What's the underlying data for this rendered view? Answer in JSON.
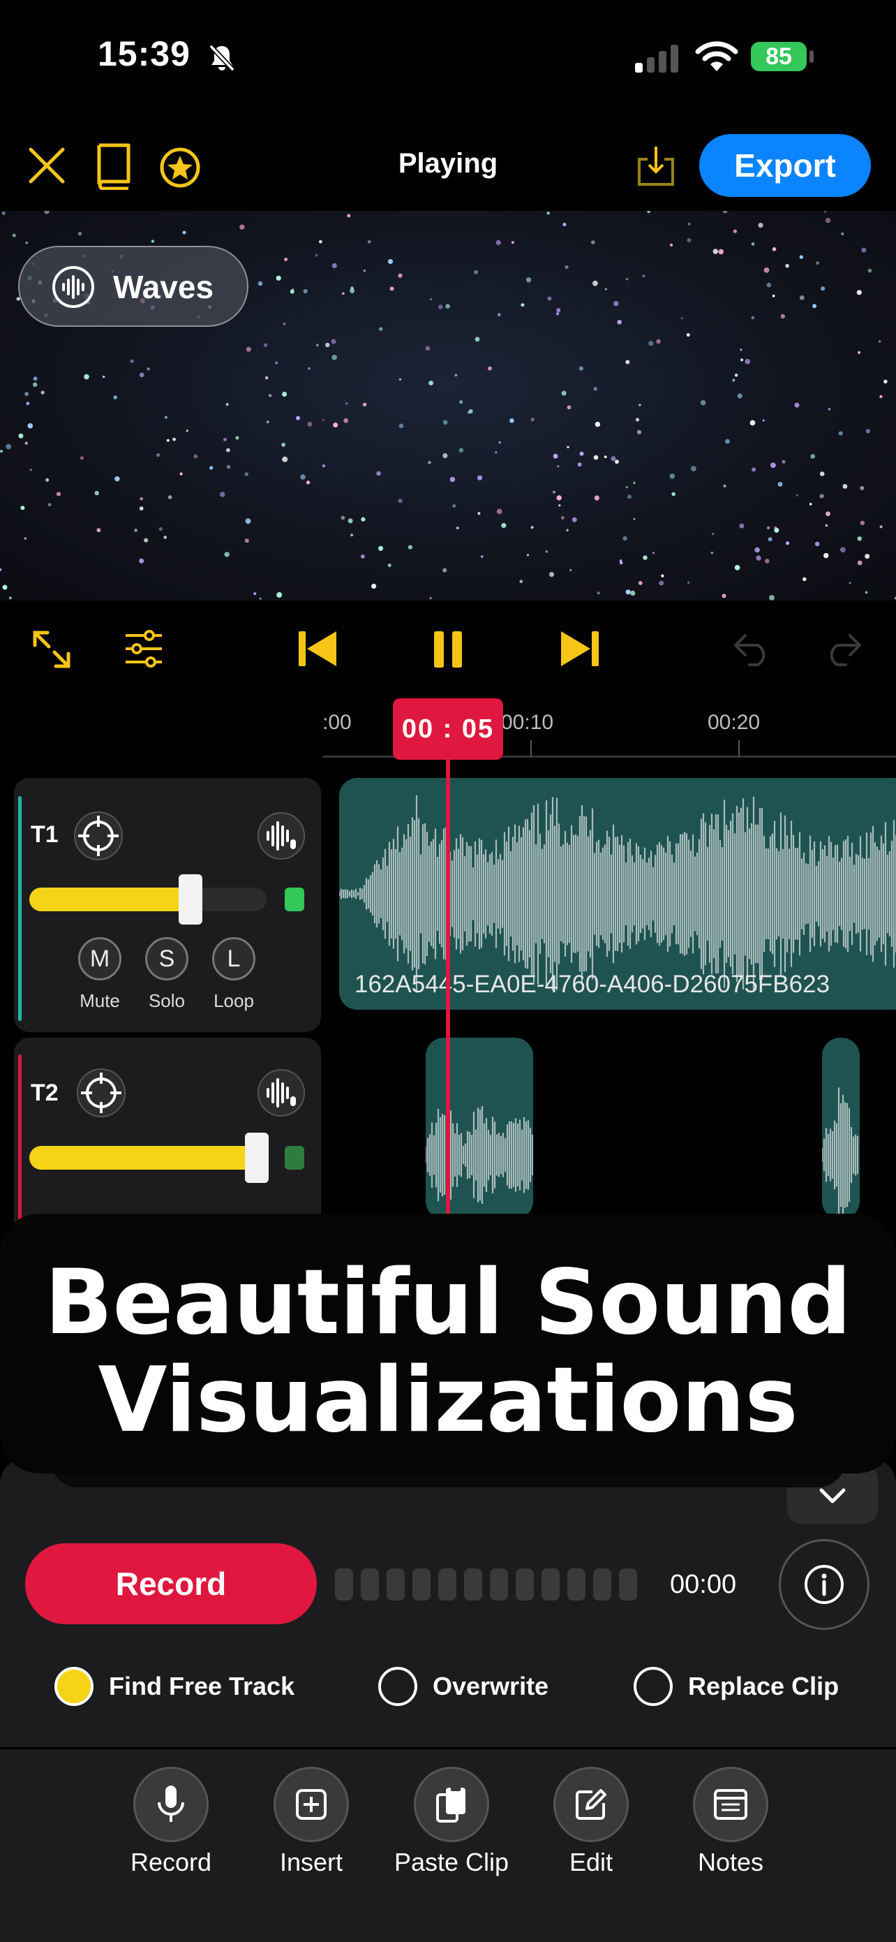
{
  "status_bar": {
    "time": "15:39",
    "battery": "85"
  },
  "toolbar": {
    "title": "Playing",
    "export_label": "Export"
  },
  "visualizer": {
    "mode_label": "Waves"
  },
  "timeline": {
    "playhead_time": "00 : 05",
    "ticks": [
      ":00",
      "00:10",
      "00:20"
    ]
  },
  "tracks": [
    {
      "name": "T1",
      "volume": 0.68,
      "clip_name": "162A5445-EA0E-4760-A406-D26075FB623",
      "buttons": [
        {
          "glyph": "M",
          "label": "Mute"
        },
        {
          "glyph": "S",
          "label": "Solo"
        },
        {
          "glyph": "L",
          "label": "Loop"
        }
      ],
      "color": "#1fb5a8"
    },
    {
      "name": "T2",
      "volume": 0.96,
      "color": "#e0173f"
    }
  ],
  "banner": {
    "line1": "Beautiful Sound",
    "line2": "Visualizations"
  },
  "recorder": {
    "record_label": "Record",
    "elapsed": "00:00",
    "modes": [
      {
        "label": "Find Free Track",
        "selected": true
      },
      {
        "label": "Overwrite",
        "selected": false
      },
      {
        "label": "Replace Clip",
        "selected": false
      }
    ]
  },
  "tabbar": {
    "items": [
      {
        "label": "Record",
        "icon": "microphone-icon"
      },
      {
        "label": "Insert",
        "icon": "plus-square-icon"
      },
      {
        "label": "Paste Clip",
        "icon": "clipboard-icon"
      },
      {
        "label": "Edit",
        "icon": "edit-icon"
      },
      {
        "label": "Notes",
        "icon": "notes-icon"
      }
    ]
  },
  "colors": {
    "accent_yellow": "#f5c518",
    "record_red": "#e0173f",
    "export_blue": "#0a84ff",
    "clip_teal": "#1f5351"
  }
}
